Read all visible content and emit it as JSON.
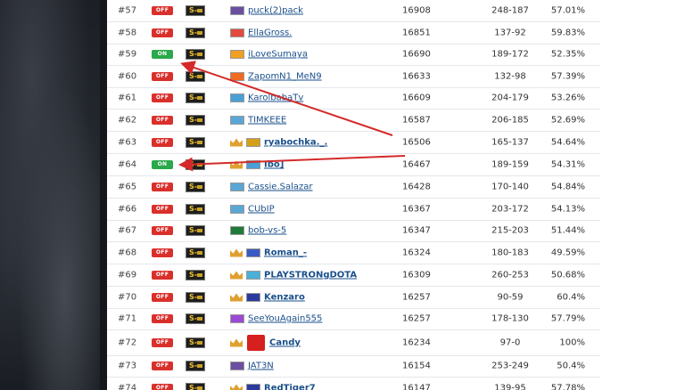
{
  "leaderboard": {
    "rows": [
      {
        "rank": "#57",
        "status": "OFF",
        "badge": "S-",
        "name": "puck(2)pack",
        "mmr": "16908",
        "wl": "248-187",
        "pct": "57.01%",
        "flag_color": "#6b4fa0",
        "crown": false,
        "bold": false
      },
      {
        "rank": "#58",
        "status": "OFF",
        "badge": "S-",
        "name": "EllaGross.",
        "mmr": "16851",
        "wl": "137-92",
        "pct": "59.83%",
        "flag_color": "#e24a3b",
        "crown": false,
        "bold": false
      },
      {
        "rank": "#59",
        "status": "ON",
        "badge": "S-",
        "name": "iLoveSumaya",
        "mmr": "16690",
        "wl": "189-172",
        "pct": "52.35%",
        "flag_color": "#f0a020",
        "crown": false,
        "bold": false
      },
      {
        "rank": "#60",
        "status": "OFF",
        "badge": "S-",
        "name": "ZapomN1_MeN9",
        "mmr": "16633",
        "wl": "132-98",
        "pct": "57.39%",
        "flag_color": "#f06a20",
        "crown": false,
        "bold": false
      },
      {
        "rank": "#61",
        "status": "OFF",
        "badge": "S-",
        "name": "KarolbabaTv",
        "mmr": "16609",
        "wl": "204-179",
        "pct": "53.26%",
        "flag_color": "#4a9fd6",
        "crown": false,
        "bold": false
      },
      {
        "rank": "#62",
        "status": "OFF",
        "badge": "S-",
        "name": "TIMKEEE",
        "mmr": "16587",
        "wl": "206-185",
        "pct": "52.69%",
        "flag_color": "#5aa7d6",
        "crown": false,
        "bold": false
      },
      {
        "rank": "#63",
        "status": "OFF",
        "badge": "S-",
        "name": "ryabochka._.",
        "mmr": "16506",
        "wl": "165-137",
        "pct": "54.64%",
        "flag_color": "#d4a017",
        "crown": true,
        "bold": true
      },
      {
        "rank": "#64",
        "status": "ON",
        "badge": "S-",
        "name": "Ibo]",
        "mmr": "16467",
        "wl": "189-159",
        "pct": "54.31%",
        "flag_color": "#4a9fd6",
        "crown": true,
        "bold": true
      },
      {
        "rank": "#65",
        "status": "OFF",
        "badge": "S-",
        "name": "Cassie.Salazar",
        "mmr": "16428",
        "wl": "170-140",
        "pct": "54.84%",
        "flag_color": "#5aa7d6",
        "crown": false,
        "bold": false
      },
      {
        "rank": "#66",
        "status": "OFF",
        "badge": "S-",
        "name": "CUbIP",
        "mmr": "16367",
        "wl": "203-172",
        "pct": "54.13%",
        "flag_color": "#5aa7d6",
        "crown": false,
        "bold": false
      },
      {
        "rank": "#67",
        "status": "OFF",
        "badge": "S-",
        "name": "bob-vs-5",
        "mmr": "16347",
        "wl": "215-203",
        "pct": "51.44%",
        "flag_color": "#1f7a3a",
        "crown": false,
        "bold": false
      },
      {
        "rank": "#68",
        "status": "OFF",
        "badge": "S-",
        "name": "Roman_-",
        "mmr": "16324",
        "wl": "180-183",
        "pct": "49.59%",
        "flag_color": "#3b5bc4",
        "crown": true,
        "bold": true
      },
      {
        "rank": "#69",
        "status": "OFF",
        "badge": "S-",
        "name": "PLAYSTRONgDOTA",
        "mmr": "16309",
        "wl": "260-253",
        "pct": "50.68%",
        "flag_color": "#4ab0d6",
        "crown": true,
        "bold": true
      },
      {
        "rank": "#70",
        "status": "OFF",
        "badge": "S-",
        "name": "Kenzaro",
        "mmr": "16257",
        "wl": "90-59",
        "pct": "60.4%",
        "flag_color": "#2a3b9c",
        "crown": true,
        "bold": true
      },
      {
        "rank": "#71",
        "status": "OFF",
        "badge": "S-",
        "name": "SeeYouAgain555",
        "mmr": "16257",
        "wl": "178-130",
        "pct": "57.79%",
        "flag_color": "#9c4ad6",
        "crown": false,
        "bold": false
      },
      {
        "rank": "#72",
        "status": "OFF",
        "badge": "S-",
        "name": "Candy",
        "mmr": "16234",
        "wl": "97-0",
        "pct": "100%",
        "flag_color": "#d61f1f",
        "crown": true,
        "bold": true
      },
      {
        "rank": "#73",
        "status": "OFF",
        "badge": "S-",
        "name": "JAT3N",
        "mmr": "16154",
        "wl": "253-249",
        "pct": "50.4%",
        "flag_color": "#6b4fa0",
        "crown": false,
        "bold": false
      },
      {
        "rank": "#74",
        "status": "OFF",
        "badge": "S-",
        "name": "RedTiger7",
        "mmr": "16147",
        "wl": "139-95",
        "pct": "57.78%",
        "flag_color": "#2a3b9c",
        "crown": true,
        "bold": true
      }
    ]
  },
  "colors": {
    "status_off": "#d9302c",
    "status_on": "#2aa84a",
    "link": "#1a4f8b",
    "arrow": "#d42a2a"
  }
}
